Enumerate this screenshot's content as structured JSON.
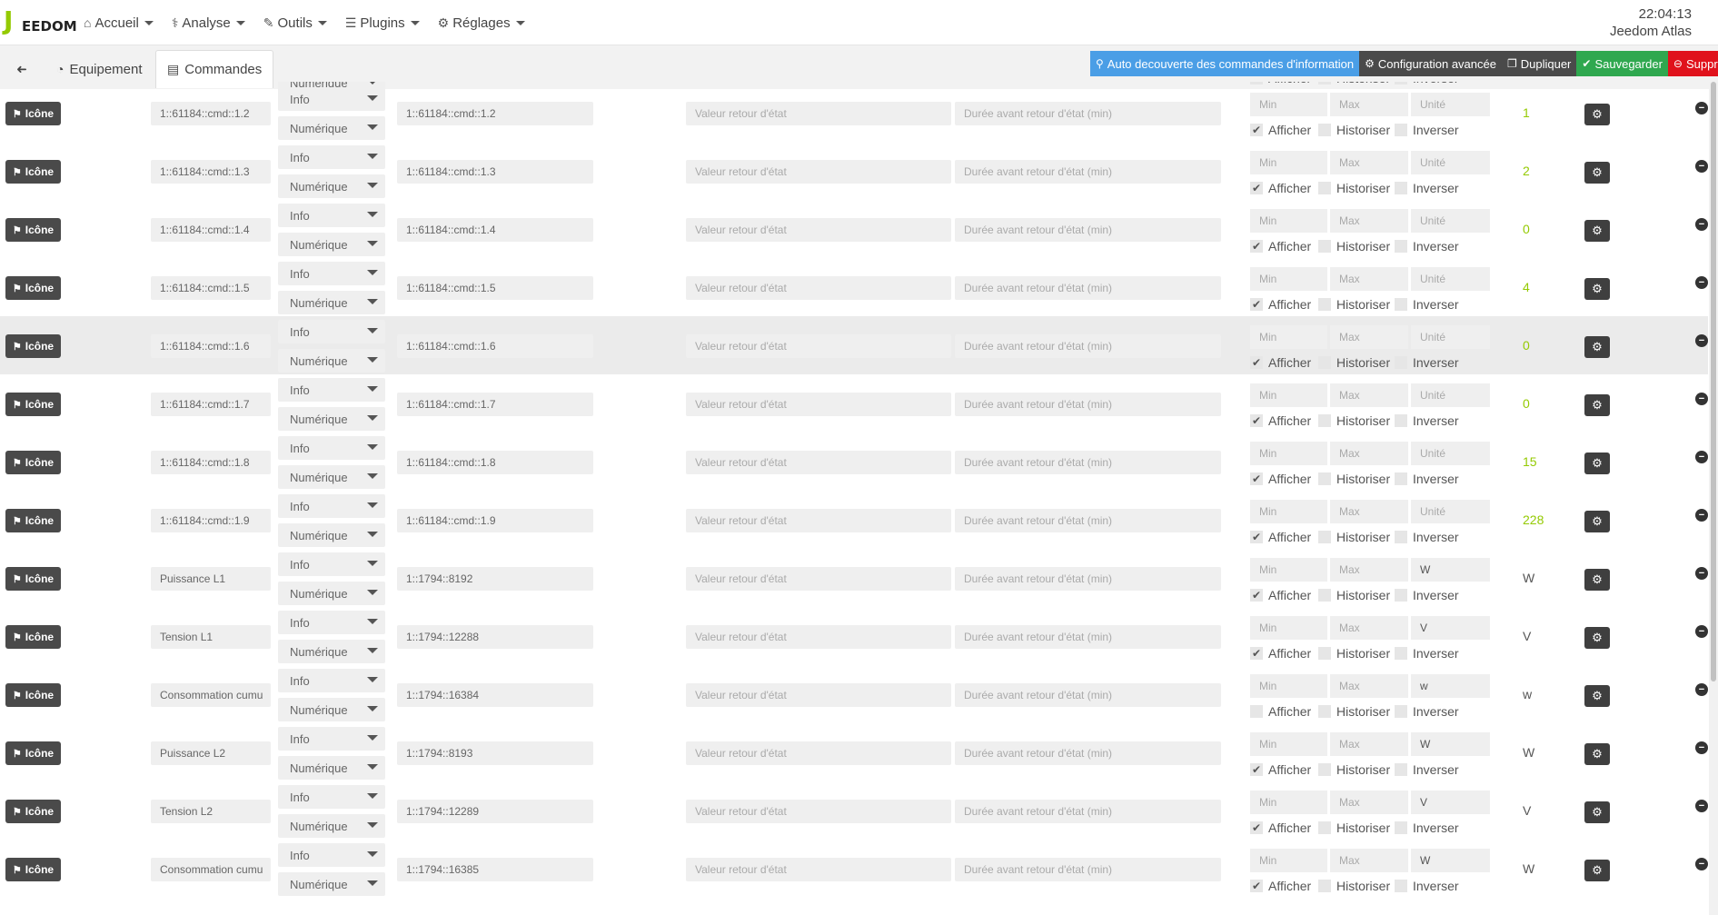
{
  "brand": {
    "logo_text_a": "J",
    "logo_text_b": "EEDOM"
  },
  "menu": [
    {
      "name": "accueil",
      "label": "Accueil",
      "icon": "home-icon",
      "glyph": "⌂"
    },
    {
      "name": "analyse",
      "label": "Analyse",
      "icon": "stethoscope-icon",
      "glyph": "⚕"
    },
    {
      "name": "outils",
      "label": "Outils",
      "icon": "wrench-icon",
      "glyph": "✎"
    },
    {
      "name": "plugins",
      "label": "Plugins",
      "icon": "list-icon",
      "glyph": "☰"
    },
    {
      "name": "reglages",
      "label": "Réglages",
      "icon": "cogs-icon",
      "glyph": "⚙"
    }
  ],
  "clock": {
    "time": "22:04:13",
    "system": "Jeedom Atlas"
  },
  "tabs": {
    "back_icon": "arrow-circle-left-icon",
    "back_glyph": "➜",
    "equipement": "Equipement",
    "commandes": "Commandes"
  },
  "actions": [
    {
      "name": "auto-discover-button",
      "label": "Auto decouverte des commandes d'information",
      "color": "#4a9ee6",
      "glyph": "⚲",
      "icon": "search-icon"
    },
    {
      "name": "advanced-config-button",
      "label": "Configuration avancée",
      "color": "#4a4a4a",
      "glyph": "⚙",
      "icon": "cogs-icon"
    },
    {
      "name": "duplicate-button",
      "label": "Dupliquer",
      "color": "#4a4a4a",
      "glyph": "❐",
      "icon": "copy-icon"
    },
    {
      "name": "save-button",
      "label": "Sauvegarder",
      "color": "#2fa84f",
      "glyph": "✔",
      "icon": "check-circle-icon"
    },
    {
      "name": "delete-button",
      "label": "Supprimer",
      "color": "#e0121c",
      "glyph": "⊖",
      "icon": "minus-circle-icon"
    }
  ],
  "labels": {
    "icone": "Icône",
    "type": "Info",
    "subtype": "Numérique",
    "valeur_retour": "Valeur retour d'état",
    "duree_retour": "Durée avant retour d'état (min)",
    "min": "Min",
    "max": "Max",
    "unite": "Unité",
    "afficher": "Afficher",
    "historiser": "Historiser",
    "inverser": "Inverser"
  },
  "partial_top": {
    "subtype": "Numérique",
    "afficher": "Afficher",
    "historiser": "Historiser",
    "inverser": "Inverser"
  },
  "rows": [
    {
      "name": "1::61184::cmd::1.2",
      "logical": "1::61184::cmd::1.2",
      "unit": "",
      "afficher": true,
      "status": "1",
      "highlight": false
    },
    {
      "name": "1::61184::cmd::1.3",
      "logical": "1::61184::cmd::1.3",
      "unit": "",
      "afficher": true,
      "status": "2",
      "highlight": false
    },
    {
      "name": "1::61184::cmd::1.4",
      "logical": "1::61184::cmd::1.4",
      "unit": "",
      "afficher": true,
      "status": "0",
      "highlight": false
    },
    {
      "name": "1::61184::cmd::1.5",
      "logical": "1::61184::cmd::1.5",
      "unit": "",
      "afficher": true,
      "status": "4",
      "highlight": false
    },
    {
      "name": "1::61184::cmd::1.6",
      "logical": "1::61184::cmd::1.6",
      "unit": "",
      "afficher": true,
      "status": "0",
      "highlight": true
    },
    {
      "name": "1::61184::cmd::1.7",
      "logical": "1::61184::cmd::1.7",
      "unit": "",
      "afficher": true,
      "status": "0",
      "highlight": false
    },
    {
      "name": "1::61184::cmd::1.8",
      "logical": "1::61184::cmd::1.8",
      "unit": "",
      "afficher": true,
      "status": "15",
      "highlight": false
    },
    {
      "name": "1::61184::cmd::1.9",
      "logical": "1::61184::cmd::1.9",
      "unit": "",
      "afficher": true,
      "status": "228",
      "highlight": false
    },
    {
      "name": "Puissance L1",
      "logical": "1::1794::8192",
      "unit": "W",
      "afficher": true,
      "status": "W",
      "highlight": false
    },
    {
      "name": "Tension L1",
      "logical": "1::1794::12288",
      "unit": "V",
      "afficher": true,
      "status": "V",
      "highlight": false
    },
    {
      "name": "Consommation cumu",
      "logical": "1::1794::16384",
      "unit": "w",
      "afficher": false,
      "status": "w",
      "highlight": false
    },
    {
      "name": "Puissance L2",
      "logical": "1::1794::8193",
      "unit": "W",
      "afficher": true,
      "status": "W",
      "highlight": false
    },
    {
      "name": "Tension L2",
      "logical": "1::1794::12289",
      "unit": "V",
      "afficher": true,
      "status": "V",
      "highlight": false
    },
    {
      "name": "Consommation cumu",
      "logical": "1::1794::16385",
      "unit": "W",
      "afficher": true,
      "status": "W",
      "highlight": false
    }
  ]
}
